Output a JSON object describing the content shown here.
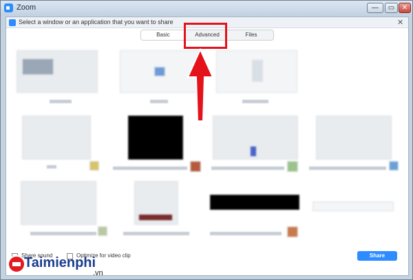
{
  "window": {
    "title": "Zoom",
    "min_glyph": "—",
    "max_glyph": "▭",
    "close_glyph": "✕"
  },
  "subheader": {
    "text": "Select a window or an application that you want to share",
    "close_glyph": "✕"
  },
  "tabs": [
    {
      "label": "Basic",
      "selected": true
    },
    {
      "label": "Advanced",
      "selected": false,
      "highlighted": true
    },
    {
      "label": "Files",
      "selected": false
    }
  ],
  "bottom": {
    "share_sound_label": "Share sound",
    "optimize_label": "Optimize for video clip",
    "share_button": "Share"
  },
  "watermark": {
    "brand": "Taimienphi",
    "suffix": ".vn"
  },
  "colors": {
    "accent": "#2d8cff",
    "highlight": "#e3121b"
  }
}
